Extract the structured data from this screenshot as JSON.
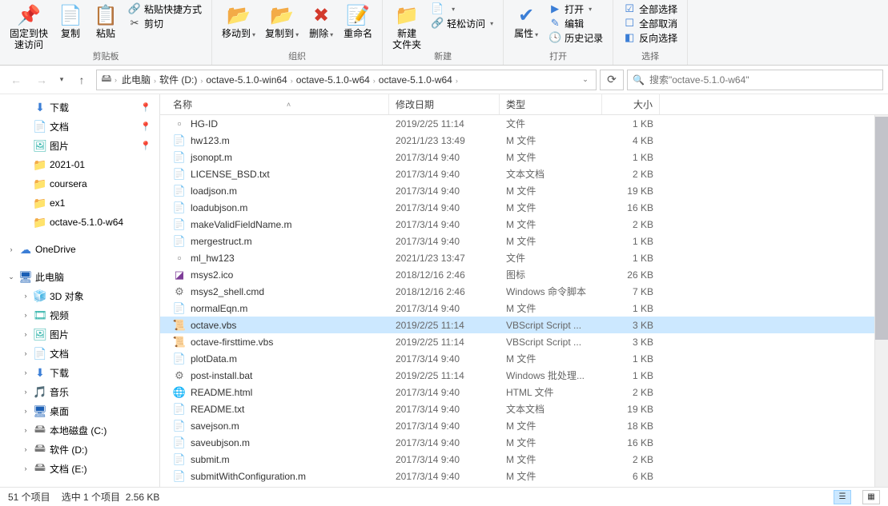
{
  "ribbon": {
    "groups": [
      {
        "label": "剪贴板",
        "items_big": [
          {
            "name": "pin-quick-access",
            "icon": "📌",
            "color": "c-blue",
            "label": "固定到快\n速访问"
          },
          {
            "name": "copy",
            "icon": "📄",
            "color": "c-blue",
            "label": "复制"
          },
          {
            "name": "paste",
            "icon": "📋",
            "color": "c-orange",
            "label": "粘贴"
          }
        ],
        "items_small": [
          {
            "name": "paste-shortcut",
            "icon": "🔗",
            "color": "c-green",
            "label": "粘贴快捷方式"
          },
          {
            "name": "cut",
            "icon": "✂",
            "color": "c-dark",
            "label": "剪切"
          }
        ]
      },
      {
        "label": "组织",
        "items_big": [
          {
            "name": "move-to",
            "icon": "📂",
            "color": "c-blue",
            "label": "移动到",
            "dropdown": true
          },
          {
            "name": "copy-to",
            "icon": "📂",
            "color": "c-blue",
            "label": "复制到",
            "dropdown": true
          },
          {
            "name": "delete",
            "icon": "✖",
            "color": "c-red",
            "label": "删除",
            "dropdown": true
          },
          {
            "name": "rename",
            "icon": "📝",
            "color": "c-blue",
            "label": "重命名"
          }
        ]
      },
      {
        "label": "新建",
        "items_big": [
          {
            "name": "new-folder",
            "icon": "📁",
            "color": "folder",
            "label": "新建\n文件夹"
          }
        ],
        "items_small": [
          {
            "name": "new-item",
            "icon": "📄",
            "color": "c-blue",
            "label": "",
            "dropdown": true
          },
          {
            "name": "easy-access",
            "icon": "🔗",
            "color": "c-green",
            "label": "轻松访问",
            "dropdown": true
          }
        ]
      },
      {
        "label": "打开",
        "items_big": [
          {
            "name": "properties",
            "icon": "✔",
            "color": "c-blue",
            "label": "属性",
            "dropdown": true
          }
        ],
        "items_small": [
          {
            "name": "open",
            "icon": "▶",
            "color": "c-blue",
            "label": "打开",
            "dropdown": true
          },
          {
            "name": "edit",
            "icon": "✎",
            "color": "c-blue",
            "label": "编辑"
          },
          {
            "name": "history",
            "icon": "🕓",
            "color": "c-orange",
            "label": "历史记录"
          }
        ]
      },
      {
        "label": "选择",
        "items_small": [
          {
            "name": "select-all",
            "icon": "☑",
            "color": "c-blue",
            "label": "全部选择"
          },
          {
            "name": "select-none",
            "icon": "☐",
            "color": "c-blue",
            "label": "全部取消"
          },
          {
            "name": "invert-selection",
            "icon": "◧",
            "color": "c-blue",
            "label": "反向选择"
          }
        ]
      }
    ]
  },
  "nav": {
    "back": "←",
    "forward": "→",
    "recent_dd": "▾",
    "up": "↑",
    "refresh": "⟳"
  },
  "breadcrumb": {
    "root_icon": "🖴",
    "items": [
      "此电脑",
      "软件 (D:)",
      "octave-5.1.0-win64",
      "octave-5.1.0-w64",
      "octave-5.1.0-w64"
    ]
  },
  "search": {
    "placeholder": "搜索\"octave-5.1.0-w64\"",
    "icon": "🔍"
  },
  "tree": [
    {
      "level": 1,
      "exp": "",
      "icon": "⬇",
      "color": "c-blue",
      "label": "下载",
      "pin": true
    },
    {
      "level": 1,
      "exp": "",
      "icon": "📄",
      "color": "c-teal",
      "label": "文档",
      "pin": true
    },
    {
      "level": 1,
      "exp": "",
      "icon": "🖼",
      "color": "c-teal",
      "label": "图片",
      "pin": true
    },
    {
      "level": 1,
      "exp": "",
      "icon": "📁",
      "color": "folder",
      "label": "2021-01"
    },
    {
      "level": 1,
      "exp": "",
      "icon": "📁",
      "color": "folder",
      "label": "coursera"
    },
    {
      "level": 1,
      "exp": "",
      "icon": "📁",
      "color": "folder",
      "label": "ex1"
    },
    {
      "level": 1,
      "exp": "",
      "icon": "📁",
      "color": "folder",
      "label": "octave-5.1.0-w64"
    },
    {
      "sep": true
    },
    {
      "level": 0,
      "exp": "›",
      "icon": "☁",
      "color": "c-blue",
      "label": "OneDrive"
    },
    {
      "sep": true
    },
    {
      "level": 0,
      "exp": "⌄",
      "icon": "🖥",
      "color": "c-dblue",
      "label": "此电脑"
    },
    {
      "level": 1,
      "exp": "›",
      "icon": "🧊",
      "color": "c-teal",
      "label": "3D 对象"
    },
    {
      "level": 1,
      "exp": "›",
      "icon": "🎞",
      "color": "c-teal",
      "label": "视频"
    },
    {
      "level": 1,
      "exp": "›",
      "icon": "🖼",
      "color": "c-teal",
      "label": "图片"
    },
    {
      "level": 1,
      "exp": "›",
      "icon": "📄",
      "color": "c-teal",
      "label": "文档"
    },
    {
      "level": 1,
      "exp": "›",
      "icon": "⬇",
      "color": "c-blue",
      "label": "下载"
    },
    {
      "level": 1,
      "exp": "›",
      "icon": "🎵",
      "color": "c-blue",
      "label": "音乐"
    },
    {
      "level": 1,
      "exp": "›",
      "icon": "🖥",
      "color": "c-dblue",
      "label": "桌面"
    },
    {
      "level": 1,
      "exp": "›",
      "icon": "🖴",
      "color": "c-gray",
      "label": "本地磁盘 (C:)"
    },
    {
      "level": 1,
      "exp": "›",
      "icon": "🖴",
      "color": "c-gray",
      "label": "软件 (D:)"
    },
    {
      "level": 1,
      "exp": "›",
      "icon": "🖴",
      "color": "c-gray",
      "label": "文档 (E:)"
    }
  ],
  "columns": {
    "name": "名称",
    "date": "修改日期",
    "type": "类型",
    "size": "大小",
    "sort_arrow": "˄"
  },
  "files": [
    {
      "icon": "▫",
      "color": "c-gray",
      "name": "HG-ID",
      "date": "2019/2/25 11:14",
      "type": "文件",
      "size": "1 KB"
    },
    {
      "icon": "📄",
      "color": "c-gray",
      "name": "hw123.m",
      "date": "2021/1/23 13:49",
      "type": "M 文件",
      "size": "4 KB"
    },
    {
      "icon": "📄",
      "color": "c-gray",
      "name": "jsonopt.m",
      "date": "2017/3/14 9:40",
      "type": "M 文件",
      "size": "1 KB"
    },
    {
      "icon": "📄",
      "color": "c-gray",
      "name": "LICENSE_BSD.txt",
      "date": "2017/3/14 9:40",
      "type": "文本文档",
      "size": "2 KB"
    },
    {
      "icon": "📄",
      "color": "c-gray",
      "name": "loadjson.m",
      "date": "2017/3/14 9:40",
      "type": "M 文件",
      "size": "19 KB"
    },
    {
      "icon": "📄",
      "color": "c-gray",
      "name": "loadubjson.m",
      "date": "2017/3/14 9:40",
      "type": "M 文件",
      "size": "16 KB"
    },
    {
      "icon": "📄",
      "color": "c-gray",
      "name": "makeValidFieldName.m",
      "date": "2017/3/14 9:40",
      "type": "M 文件",
      "size": "2 KB"
    },
    {
      "icon": "📄",
      "color": "c-gray",
      "name": "mergestruct.m",
      "date": "2017/3/14 9:40",
      "type": "M 文件",
      "size": "1 KB"
    },
    {
      "icon": "▫",
      "color": "c-gray",
      "name": "ml_hw123",
      "date": "2021/1/23 13:47",
      "type": "文件",
      "size": "1 KB"
    },
    {
      "icon": "◪",
      "color": "c-purple",
      "name": "msys2.ico",
      "date": "2018/12/16 2:46",
      "type": "图标",
      "size": "26 KB"
    },
    {
      "icon": "⚙",
      "color": "c-gray",
      "name": "msys2_shell.cmd",
      "date": "2018/12/16 2:46",
      "type": "Windows 命令脚本",
      "size": "7 KB"
    },
    {
      "icon": "📄",
      "color": "c-gray",
      "name": "normalEqn.m",
      "date": "2017/3/14 9:40",
      "type": "M 文件",
      "size": "1 KB"
    },
    {
      "icon": "📜",
      "color": "c-gray",
      "name": "octave.vbs",
      "date": "2019/2/25 11:14",
      "type": "VBScript Script ...",
      "size": "3 KB",
      "selected": true
    },
    {
      "icon": "📜",
      "color": "c-gray",
      "name": "octave-firsttime.vbs",
      "date": "2019/2/25 11:14",
      "type": "VBScript Script ...",
      "size": "3 KB"
    },
    {
      "icon": "📄",
      "color": "c-gray",
      "name": "plotData.m",
      "date": "2017/3/14 9:40",
      "type": "M 文件",
      "size": "1 KB"
    },
    {
      "icon": "⚙",
      "color": "c-gray",
      "name": "post-install.bat",
      "date": "2019/2/25 11:14",
      "type": "Windows 批处理...",
      "size": "1 KB"
    },
    {
      "icon": "🌐",
      "color": "c-blue",
      "name": "README.html",
      "date": "2017/3/14 9:40",
      "type": "HTML 文件",
      "size": "2 KB"
    },
    {
      "icon": "📄",
      "color": "c-gray",
      "name": "README.txt",
      "date": "2017/3/14 9:40",
      "type": "文本文档",
      "size": "19 KB"
    },
    {
      "icon": "📄",
      "color": "c-gray",
      "name": "savejson.m",
      "date": "2017/3/14 9:40",
      "type": "M 文件",
      "size": "18 KB"
    },
    {
      "icon": "📄",
      "color": "c-gray",
      "name": "saveubjson.m",
      "date": "2017/3/14 9:40",
      "type": "M 文件",
      "size": "16 KB"
    },
    {
      "icon": "📄",
      "color": "c-gray",
      "name": "submit.m",
      "date": "2017/3/14 9:40",
      "type": "M 文件",
      "size": "2 KB"
    },
    {
      "icon": "📄",
      "color": "c-gray",
      "name": "submitWithConfiguration.m",
      "date": "2017/3/14 9:40",
      "type": "M 文件",
      "size": "6 KB"
    }
  ],
  "status": {
    "count": "51 个项目",
    "selection": "选中 1 个项目",
    "size": "2.56 KB"
  }
}
